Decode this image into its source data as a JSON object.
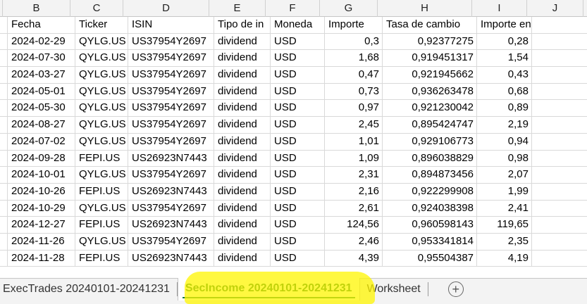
{
  "columns": [
    "B",
    "C",
    "D",
    "E",
    "F",
    "G",
    "H",
    "I",
    "J"
  ],
  "headers": [
    "Fecha",
    "Ticker",
    "ISIN",
    "Tipo de in",
    "Moneda",
    "Importe",
    "Tasa de cambio",
    "Importe en EUR",
    ""
  ],
  "rows": [
    [
      "2024-02-29",
      "QYLG.US",
      "US37954Y2697",
      "dividend",
      "USD",
      "0,3",
      "0,92377275",
      "0,28",
      ""
    ],
    [
      "2024-07-30",
      "QYLG.US",
      "US37954Y2697",
      "dividend",
      "USD",
      "1,68",
      "0,919451317",
      "1,54",
      ""
    ],
    [
      "2024-03-27",
      "QYLG.US",
      "US37954Y2697",
      "dividend",
      "USD",
      "0,47",
      "0,921945662",
      "0,43",
      ""
    ],
    [
      "2024-05-01",
      "QYLG.US",
      "US37954Y2697",
      "dividend",
      "USD",
      "0,73",
      "0,936263478",
      "0,68",
      ""
    ],
    [
      "2024-05-30",
      "QYLG.US",
      "US37954Y2697",
      "dividend",
      "USD",
      "0,97",
      "0,921230042",
      "0,89",
      ""
    ],
    [
      "2024-08-27",
      "QYLG.US",
      "US37954Y2697",
      "dividend",
      "USD",
      "2,45",
      "0,895424747",
      "2,19",
      ""
    ],
    [
      "2024-07-02",
      "QYLG.US",
      "US37954Y2697",
      "dividend",
      "USD",
      "1,01",
      "0,929106773",
      "0,94",
      ""
    ],
    [
      "2024-09-28",
      "FEPI.US",
      "US26923N7443",
      "dividend",
      "USD",
      "1,09",
      "0,896038829",
      "0,98",
      ""
    ],
    [
      "2024-10-01",
      "QYLG.US",
      "US37954Y2697",
      "dividend",
      "USD",
      "2,31",
      "0,894873456",
      "2,07",
      ""
    ],
    [
      "2024-10-26",
      "FEPI.US",
      "US26923N7443",
      "dividend",
      "USD",
      "2,16",
      "0,922299908",
      "1,99",
      ""
    ],
    [
      "2024-10-29",
      "QYLG.US",
      "US37954Y2697",
      "dividend",
      "USD",
      "2,61",
      "0,924038398",
      "2,41",
      ""
    ],
    [
      "2024-12-27",
      "FEPI.US",
      "US26923N7443",
      "dividend",
      "USD",
      "124,56",
      "0,960598143",
      "119,65",
      ""
    ],
    [
      "2024-11-26",
      "QYLG.US",
      "US37954Y2697",
      "dividend",
      "USD",
      "2,46",
      "0,953341814",
      "2,35",
      ""
    ],
    [
      "2024-11-28",
      "FEPI.US",
      "US26923N7443",
      "dividend",
      "USD",
      "4,39",
      "0,95504387",
      "4,19",
      ""
    ]
  ],
  "tabs": {
    "first": "ExecTrades 20240101-20241231",
    "active": "SecIncome 20240101-20241231",
    "third": "Worksheet",
    "add": "+"
  }
}
